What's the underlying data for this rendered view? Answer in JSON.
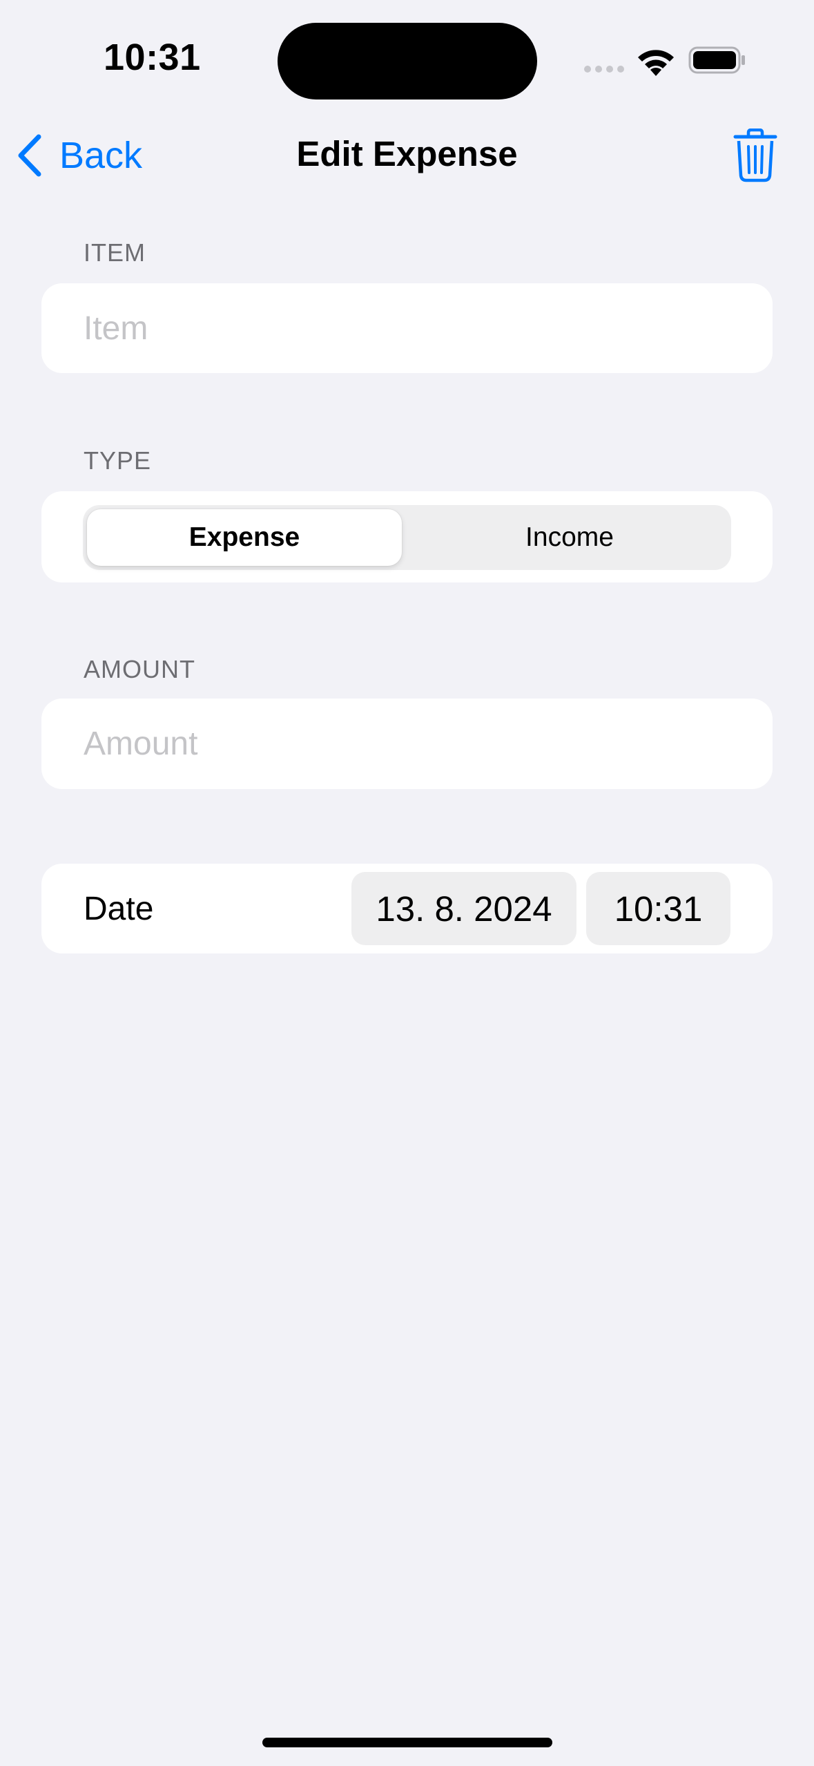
{
  "status_bar": {
    "time": "10:31"
  },
  "nav": {
    "back_label": "Back",
    "title": "Edit Expense",
    "trash_icon": "trash-icon"
  },
  "form": {
    "item": {
      "header": "ITEM",
      "value": "",
      "placeholder": "Item"
    },
    "type": {
      "header": "TYPE",
      "options": [
        "Expense",
        "Income"
      ],
      "selected": "Expense"
    },
    "amount": {
      "header": "AMOUNT",
      "value": "",
      "placeholder": "Amount"
    },
    "date": {
      "label": "Date",
      "date_value": "13. 8. 2024",
      "time_value": "10:31"
    }
  },
  "colors": {
    "accent": "#007aff",
    "background": "#f2f2f7",
    "card": "#ffffff",
    "secondary_text": "#6d6d72",
    "placeholder": "#c4c4c7",
    "pill_fill": "#eeeeef"
  }
}
